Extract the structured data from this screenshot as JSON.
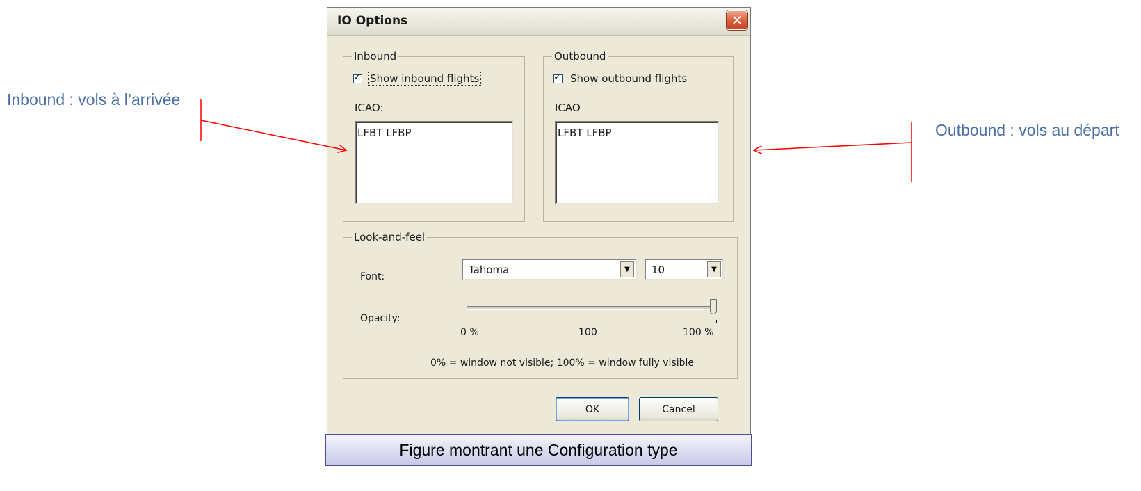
{
  "annotations": {
    "left": "Inbound : vols à l’arrivée",
    "right": "Outbound : vols au départ",
    "arrow_color": "#ff0000",
    "text_color": "#4a6fa5"
  },
  "dialog": {
    "title": "IO Options",
    "close_icon": "close-icon",
    "inbound": {
      "group_label": "Inbound",
      "checkbox_label": "Show inbound flights",
      "checked": true,
      "icao_label": "ICAO:",
      "icao_value": "LFBT LFBP"
    },
    "outbound": {
      "group_label": "Outbound",
      "checkbox_label": "Show outbound flights",
      "checked": true,
      "icao_label": "ICAO",
      "icao_value": "LFBT LFBP"
    },
    "look_and_feel": {
      "group_label": "Look-and-feel",
      "font_label": "Font:",
      "font_value": "Tahoma",
      "size_value": "10",
      "opacity_label": "Opacity:",
      "opacity_ticks": [
        "0 %",
        "100",
        "100 %"
      ],
      "opacity_value_percent": 100,
      "opacity_note": "0% = window not visible; 100% = window fully visible"
    },
    "buttons": {
      "ok": "OK",
      "cancel": "Cancel"
    }
  },
  "caption": "Figure montrant une Configuration type"
}
